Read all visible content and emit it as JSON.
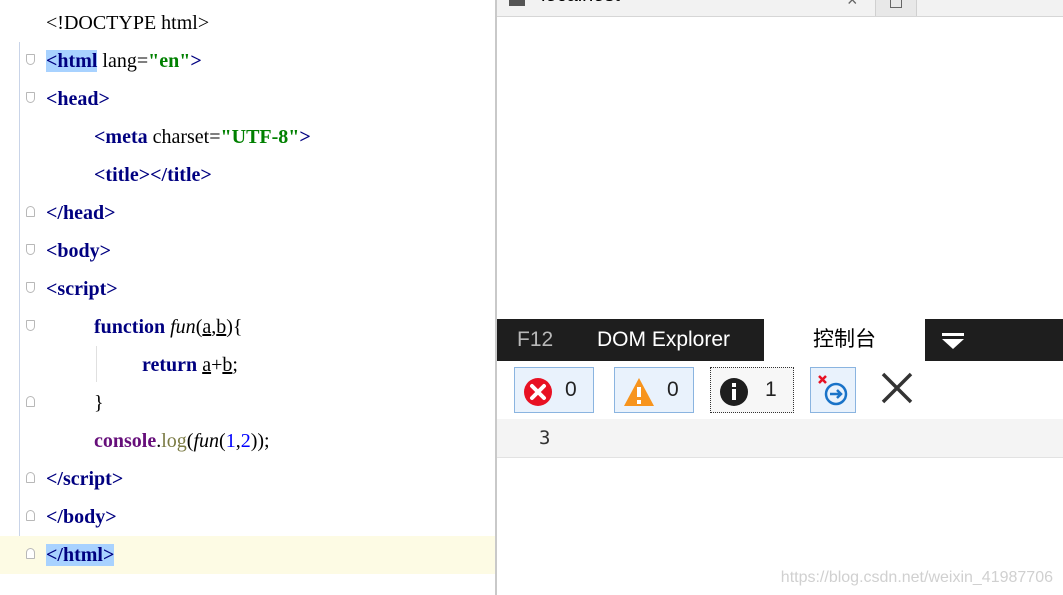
{
  "editor": {
    "lines": [
      {
        "t1": "<!DOCTYPE html>"
      },
      {
        "t1": "<",
        "t2": "html",
        "t3": " lang=",
        "t4": "\"en\"",
        "t5": ">"
      },
      {
        "t1": "<",
        "t2": "head",
        "t3": ">"
      },
      {
        "t1": "<",
        "t2": "meta",
        "t3": " charset=",
        "t4": "\"UTF-8\"",
        "t5": ">"
      },
      {
        "t1": "<",
        "t2": "title",
        "t3": "></",
        "t4": "title",
        "t5": ">"
      },
      {
        "t1": "</",
        "t2": "head",
        "t3": ">"
      },
      {
        "t1": "<",
        "t2": "body",
        "t3": ">"
      },
      {
        "t1": "<",
        "t2": "script",
        "t3": ">"
      },
      {
        "t1": "function",
        "t2": " ",
        "t3": "fun",
        "t4": "(",
        "t5": "a",
        "t6": ",",
        "t7": "b",
        "t8": "){"
      },
      {
        "t1": "return",
        "t2": " ",
        "t3": "a",
        "t4": "+",
        "t5": "b",
        "t6": ";"
      },
      {
        "t1": "}"
      },
      {
        "t1": "console",
        "t2": ".",
        "t3": "log",
        "t4": "(",
        "t5": "fun",
        "t6": "(",
        "t7": "1",
        "t8": ",",
        "t9": "2",
        "t10": "));"
      },
      {
        "t1": "</",
        "t2": "script",
        "t3": ">"
      },
      {
        "t1": "</",
        "t2": "body",
        "t3": ">"
      },
      {
        "t1": "</",
        "t2": "html",
        "t3": ">"
      }
    ]
  },
  "browser": {
    "tab_title": "localhost",
    "tab_close": "×",
    "devtools": {
      "f12_label": "F12",
      "tabs": [
        "DOM Explorer",
        "控制台"
      ],
      "error_count": "0",
      "warning_count": "0",
      "info_count": "1"
    },
    "console_output": "3"
  },
  "watermark": "https://blog.csdn.net/weixin_41987706",
  "colors": {
    "tag": "#000080",
    "string": "#008000",
    "devtools_bar": "#1e1e1e",
    "error": "#e81123",
    "warning": "#f7941d"
  }
}
